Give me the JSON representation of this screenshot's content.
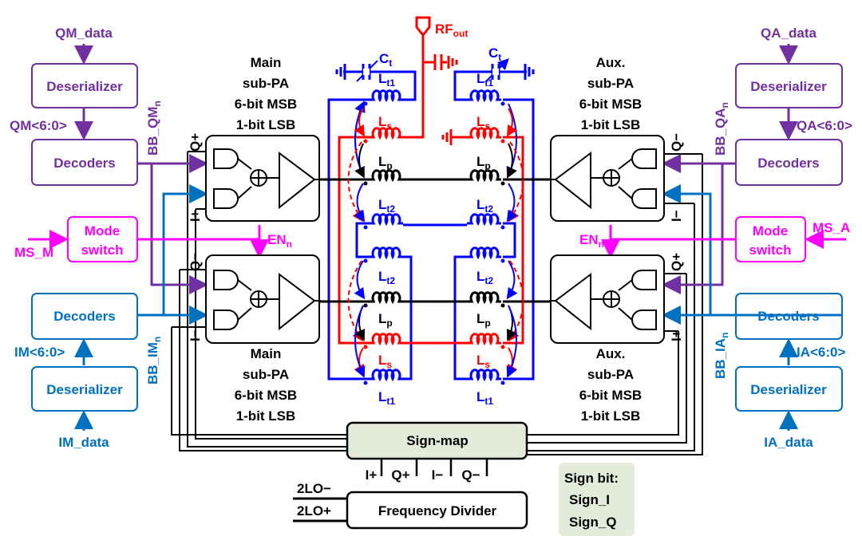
{
  "left": {
    "q_data": "QM_data",
    "q_deserializer": "Deserializer",
    "q_bus": "QM<6:0>",
    "q_decoders": "Decoders",
    "mode_switch": [
      "Mode",
      "switch"
    ],
    "ms_input": "MS_M",
    "i_decoders": "Decoders",
    "i_bus": "IM<6:0>",
    "i_deserializer": "Deserializer",
    "i_data": "IM_data",
    "bb_q": {
      "main": "BB_QM",
      "sub": "n"
    },
    "bb_i": {
      "main": "BB_IM",
      "sub": "n"
    }
  },
  "right": {
    "q_data": "QA_data",
    "q_deserializer": "Deserializer",
    "q_bus": "QA<6:0>",
    "q_decoders": "Decoders",
    "mode_switch": [
      "Mode",
      "switch"
    ],
    "ms_input": "MS_A",
    "i_decoders": "Decoders",
    "i_bus": "IA<6:0>",
    "i_deserializer": "Deserializer",
    "i_data": "IA_data",
    "bb_q": {
      "main": "BB_QA",
      "sub": "n"
    },
    "bb_i": {
      "main": "BB_IA",
      "sub": "n"
    }
  },
  "main_pa": {
    "lines": [
      "Main",
      "sub-PA",
      "6-bit MSB",
      "1-bit LSB"
    ],
    "upper_ports": [
      "Q+",
      "I+"
    ],
    "lower_ports": [
      "Q−",
      "I−"
    ]
  },
  "aux_pa": {
    "lines": [
      "Aux.",
      "sub-PA",
      "6-bit MSB",
      "1-bit LSB"
    ],
    "upper_ports": [
      "Q−",
      "I−"
    ],
    "lower_ports": [
      "Q+",
      "I+"
    ]
  },
  "enable": {
    "main": "EN",
    "sub": "n"
  },
  "combiner": {
    "rf_out": {
      "main": "RF",
      "sub": "out"
    },
    "ct": {
      "main": "C",
      "sub": "t"
    },
    "lt1": {
      "main": "L",
      "sub": "t1"
    },
    "ls": {
      "main": "L",
      "sub": "s"
    },
    "lp": {
      "main": "L",
      "sub": "p"
    },
    "lt2": {
      "main": "L",
      "sub": "t2"
    }
  },
  "sign_map": "Sign-map",
  "lo_phases": [
    "I+",
    "Q+",
    "I−",
    "Q−"
  ],
  "frequency_divider": "Frequency Divider",
  "lo_minus": "2LO−",
  "lo_plus": "2LO+",
  "sign_bit": {
    "title": "Sign bit:",
    "items": [
      "Sign_I",
      "Sign_Q"
    ]
  },
  "colors": {
    "q_path": "#7030A0",
    "i_path": "#0070C0",
    "mode": "#FF00FF",
    "tuning": "#0000FF",
    "output": "#FF0000",
    "sign_map_fill": "#E4EBDA"
  }
}
